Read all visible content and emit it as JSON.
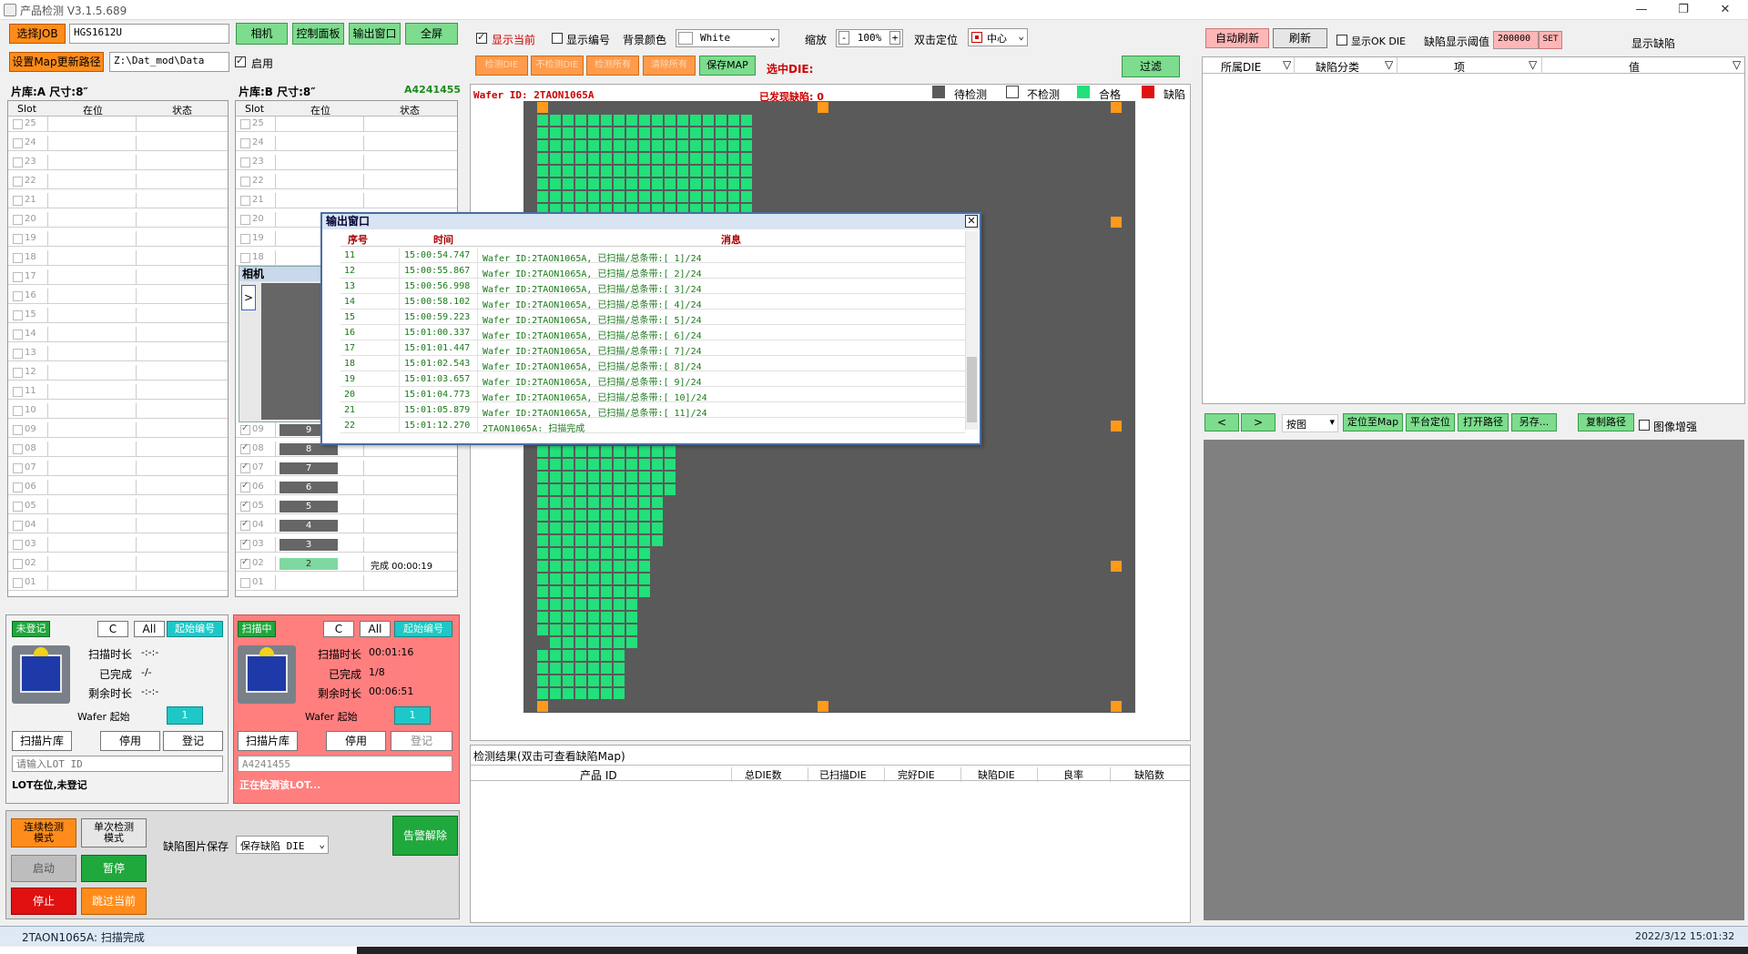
{
  "app": {
    "title": "产品检测 V3.1.5.689"
  },
  "left": {
    "select_job": "选择JOB",
    "job_value": "HGS1612U",
    "set_path": "设置Map更新路径",
    "path_value": "Z:\\Dat_mod\\Data",
    "enable_label": "启用",
    "top_buttons": [
      "相机",
      "控制面板",
      "输出窗口",
      "全屏"
    ],
    "cassetteA": {
      "header": "片库:A 尺寸:8″",
      "cols": [
        "Slot",
        "在位",
        "状态"
      ],
      "slots": [
        "25",
        "24",
        "23",
        "22",
        "21",
        "20",
        "19",
        "18",
        "17",
        "16",
        "15",
        "14",
        "13",
        "12",
        "11",
        "10",
        "09",
        "08",
        "07",
        "06",
        "05",
        "04",
        "03",
        "02",
        "01"
      ]
    },
    "cassetteB": {
      "header": "片库:B 尺寸:8″",
      "lot": "A4241455",
      "cols": [
        "Slot",
        "在位",
        "状态"
      ],
      "slots": [
        "25",
        "24",
        "23",
        "22",
        "21",
        "20",
        "19",
        "18"
      ],
      "lower_slots": [
        "09",
        "08",
        "07",
        "06",
        "05",
        "04",
        "03",
        "02",
        "01"
      ],
      "bars": [
        "9",
        "8",
        "7",
        "6",
        "5",
        "4",
        "3",
        "2"
      ],
      "slot02_status": "完成 00:00:19"
    },
    "camera_label": "相机",
    "stA": {
      "badge": "未登记",
      "c": "C",
      "all": "All",
      "start_no": "起始编号",
      "scan_time_l": "扫描时长",
      "scan_time_v": "-:-:-",
      "done_l": "已完成",
      "done_v": "-/-",
      "remain_l": "剩余时长",
      "remain_v": "-:-:-",
      "wafer_start": "Wafer 起始",
      "wafer_start_v": "1",
      "scan_lib": "扫描片库",
      "stop": "停用",
      "register": "登记",
      "lot_placeholder": "请输入LOT ID",
      "msg": "LOT在位,未登记"
    },
    "stB": {
      "badge": "扫描中",
      "c": "C",
      "all": "All",
      "start_no": "起始编号",
      "scan_time_l": "扫描时长",
      "scan_time_v": "00:01:16",
      "done_l": "已完成",
      "done_v": "1/8",
      "remain_l": "剩余时长",
      "remain_v": "00:06:51",
      "wafer_start": "Wafer 起始",
      "wafer_start_v": "1",
      "scan_lib": "扫描片库",
      "stop": "停用",
      "register": "登记",
      "lot_value": "A4241455",
      "msg": "正在检测该LOT..."
    },
    "bottom": {
      "continuous": "连续检测\n模式",
      "single": "单次检测\n模式",
      "start": "启动",
      "pause": "暂停",
      "stop": "停止",
      "skip": "跳过当前",
      "save_label": "缺陷图片保存",
      "save_value": "保存缺陷 DIE",
      "alarm": "告警解除"
    }
  },
  "middle": {
    "show_current": "显示当前",
    "show_number": "显示编号",
    "bg_label": "背景颜色",
    "bg_value": "White",
    "zoom_label": "缩放",
    "zoom_value": "100%",
    "dbl_label": "双击定位",
    "dbl_value": "中心",
    "actions": [
      "检测DIE",
      "不检测DIE",
      "检测所有",
      "清除所有",
      "保存MAP"
    ],
    "selected_die": "选中DIE:",
    "filter": "过滤",
    "wafer_id": "Wafer ID: 2TAON1065A",
    "found_defects": "已发现缺陷: 0",
    "legend": {
      "pending": "待检测",
      "skip": "不检测",
      "pass": "合格",
      "defect": "缺陷"
    },
    "colors": {
      "pending": "#5a5a5a",
      "skip": "#ffffff",
      "pass": "#22e07a",
      "defect": "#e01010",
      "marker": "#ff9a1a"
    },
    "results_title": "检测结果(双击可查看缺陷Map)",
    "results_cols": [
      "产品 ID",
      "总DIE数",
      "已扫描DIE",
      "完好DIE",
      "缺陷DIE",
      "良率",
      "缺陷数"
    ]
  },
  "output": {
    "title": "输出窗口",
    "cols": [
      "序号",
      "时间",
      "消息"
    ],
    "rows": [
      {
        "no": "11",
        "time": "15:00:54.747",
        "msg": "Wafer ID:2TAON1065A, 已扫描/总条带:[ 1]/24"
      },
      {
        "no": "12",
        "time": "15:00:55.867",
        "msg": "Wafer ID:2TAON1065A, 已扫描/总条带:[ 2]/24"
      },
      {
        "no": "13",
        "time": "15:00:56.998",
        "msg": "Wafer ID:2TAON1065A, 已扫描/总条带:[ 3]/24"
      },
      {
        "no": "14",
        "time": "15:00:58.102",
        "msg": "Wafer ID:2TAON1065A, 已扫描/总条带:[ 4]/24"
      },
      {
        "no": "15",
        "time": "15:00:59.223",
        "msg": "Wafer ID:2TAON1065A, 已扫描/总条带:[ 5]/24"
      },
      {
        "no": "16",
        "time": "15:01:00.337",
        "msg": "Wafer ID:2TAON1065A, 已扫描/总条带:[ 6]/24"
      },
      {
        "no": "17",
        "time": "15:01:01.447",
        "msg": "Wafer ID:2TAON1065A, 已扫描/总条带:[ 7]/24"
      },
      {
        "no": "18",
        "time": "15:01:02.543",
        "msg": "Wafer ID:2TAON1065A, 已扫描/总条带:[ 8]/24"
      },
      {
        "no": "19",
        "time": "15:01:03.657",
        "msg": "Wafer ID:2TAON1065A, 已扫描/总条带:[ 9]/24"
      },
      {
        "no": "20",
        "time": "15:01:04.773",
        "msg": "Wafer ID:2TAON1065A, 已扫描/总条带:[ 10]/24"
      },
      {
        "no": "21",
        "time": "15:01:05.879",
        "msg": "Wafer ID:2TAON1065A, 已扫描/总条带:[ 11]/24"
      },
      {
        "no": "22",
        "time": "15:01:12.270",
        "msg": "2TAON1065A: 扫描完成"
      }
    ]
  },
  "right": {
    "auto_refresh": "自动刷新",
    "refresh": "刷新",
    "show_ok": "显示OK DIE",
    "threshold_label": "缺陷显示阈值",
    "threshold_value": "200000",
    "set": "SET",
    "show_defect": "显示缺陷",
    "cols": [
      "所属DIE",
      "缺陷分类",
      "项",
      "值"
    ],
    "nav_prev": "<",
    "nav_next": ">",
    "mode_value": "按图",
    "tools": [
      "定位至Map",
      "平台定位",
      "打开路径",
      "另存...",
      "复制路径"
    ],
    "enhance": "图像增强"
  },
  "statusbar": {
    "msg": "2TAON1065A: 扫描完成",
    "datetime": "2022/3/12 15:01:32"
  }
}
